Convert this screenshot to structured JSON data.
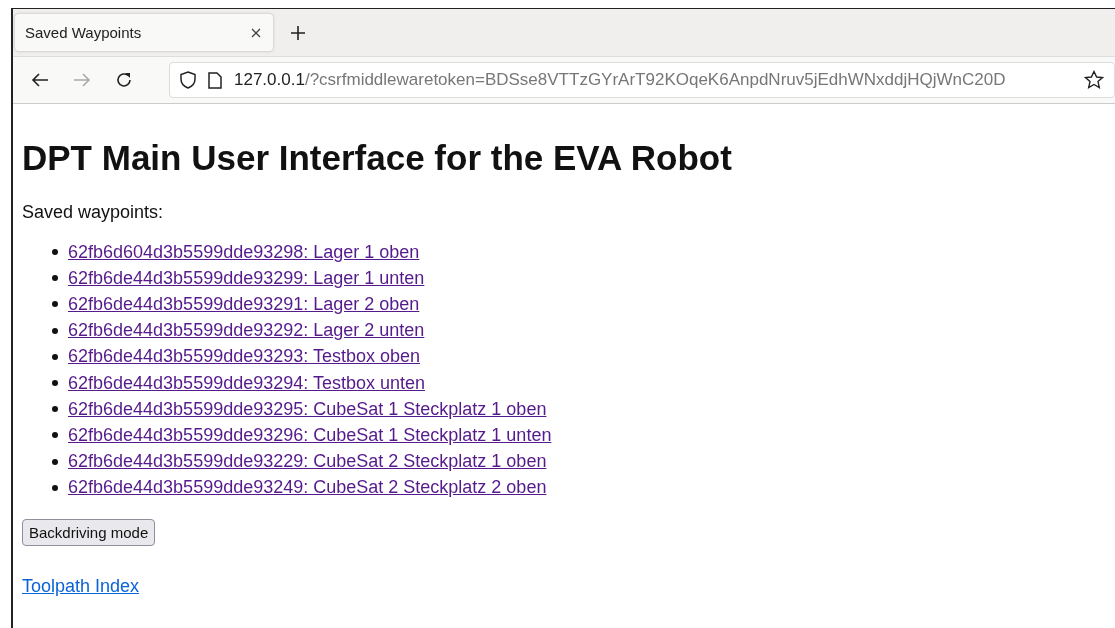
{
  "browser": {
    "tabs": [
      {
        "title": "Saved Waypoints",
        "selected": true
      }
    ],
    "address": {
      "host": "127.0.0.1",
      "path": "/?csrfmiddlewaretoken=BDSse8VTTzGYrArT92KOqeK6AnpdNruv5jEdhWNxddjHQjWnC20D"
    },
    "forward_disabled": true
  },
  "page": {
    "heading": "DPT Main User Interface for the EVA Robot",
    "intro": "Saved waypoints:",
    "waypoints": [
      {
        "label": "62fb6d604d3b5599dde93298: Lager 1 oben",
        "visited": true
      },
      {
        "label": "62fb6de44d3b5599dde93299: Lager 1 unten",
        "visited": true
      },
      {
        "label": "62fb6de44d3b5599dde93291: Lager 2 oben",
        "visited": true
      },
      {
        "label": "62fb6de44d3b5599dde93292: Lager 2 unten",
        "visited": true
      },
      {
        "label": "62fb6de44d3b5599dde93293: Testbox oben",
        "visited": true
      },
      {
        "label": "62fb6de44d3b5599dde93294: Testbox unten",
        "visited": true
      },
      {
        "label": "62fb6de44d3b5599dde93295: CubeSat 1 Steckplatz 1 oben",
        "visited": true
      },
      {
        "label": "62fb6de44d3b5599dde93296: CubeSat 1 Steckplatz 1 unten",
        "visited": true
      },
      {
        "label": "62fb6de44d3b5599dde93229: CubeSat 2 Steckplatz 1 oben",
        "visited": true
      },
      {
        "label": "62fb6de44d3b5599dde93249: CubeSat 2 Steckplatz 2 oben",
        "visited": true
      }
    ],
    "button": "Backdriving mode",
    "footer_link": {
      "label": "Toolpath Index",
      "visited": false
    }
  }
}
